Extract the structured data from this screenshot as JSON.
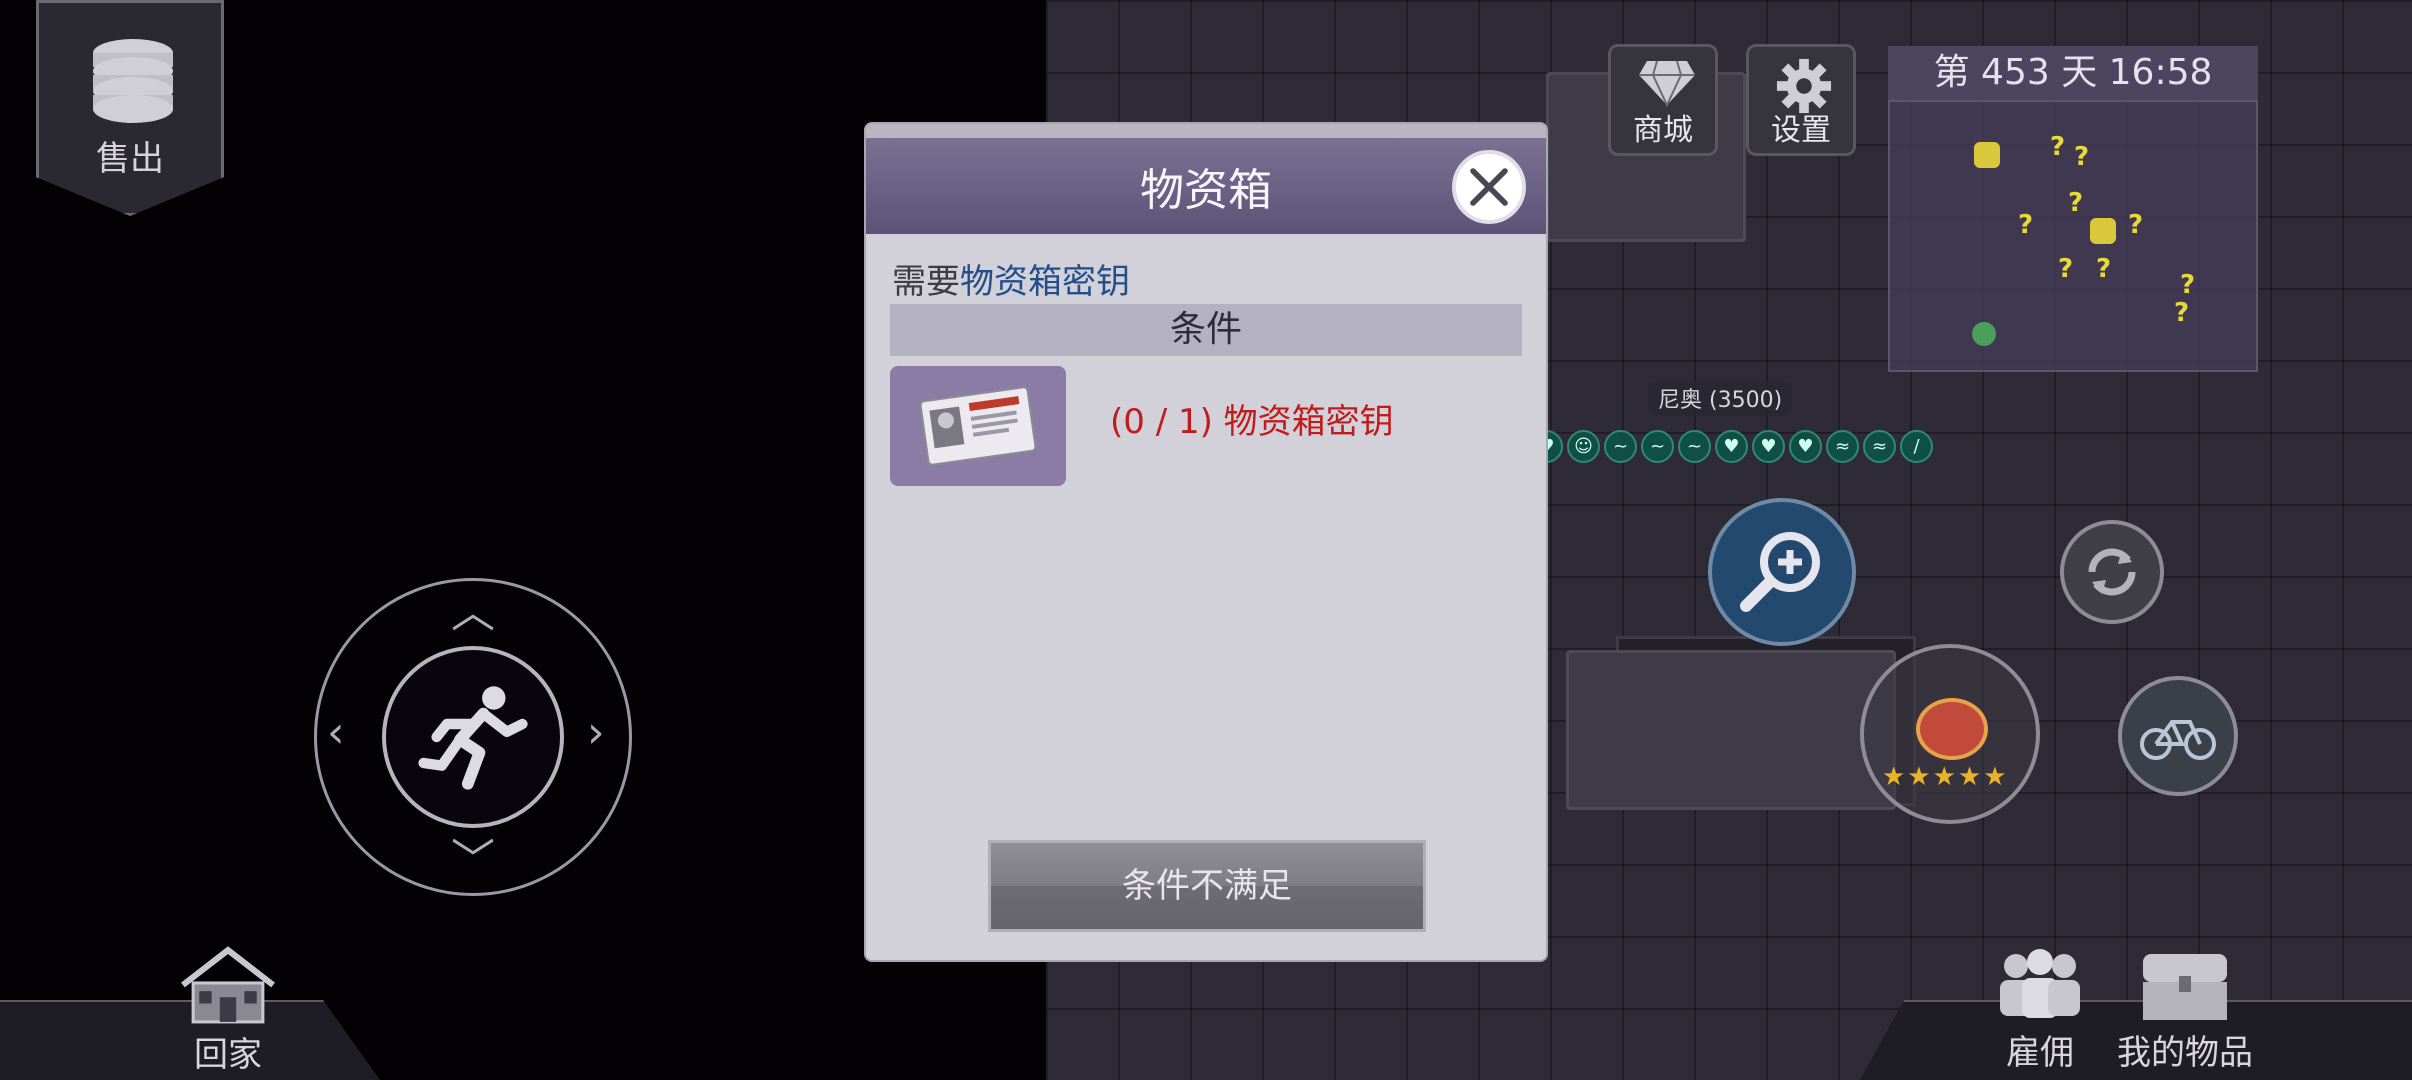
{
  "sell": {
    "label": "售出",
    "icon": "coin-stack-icon"
  },
  "top_buttons": {
    "shop_label": "商城",
    "settings_label": "设置"
  },
  "status": {
    "day_time": "第 453 天  16:58"
  },
  "npc": {
    "name_label": "尼奥 (3500)"
  },
  "dialog": {
    "title": "物资箱",
    "requirement_prefix": "需要",
    "requirement_item": "物资箱密钥",
    "conditions_header": "条件",
    "item_requirement": "(0 / 1) 物资箱密钥",
    "action_button": "条件不满足"
  },
  "bottom_nav": {
    "home_label": "回家",
    "hire_label": "雇佣",
    "items_label": "我的物品"
  },
  "colors": {
    "dialog_header": "#6b6386",
    "requirement_link": "#224e8a",
    "unmet_text": "#c21b1b"
  }
}
